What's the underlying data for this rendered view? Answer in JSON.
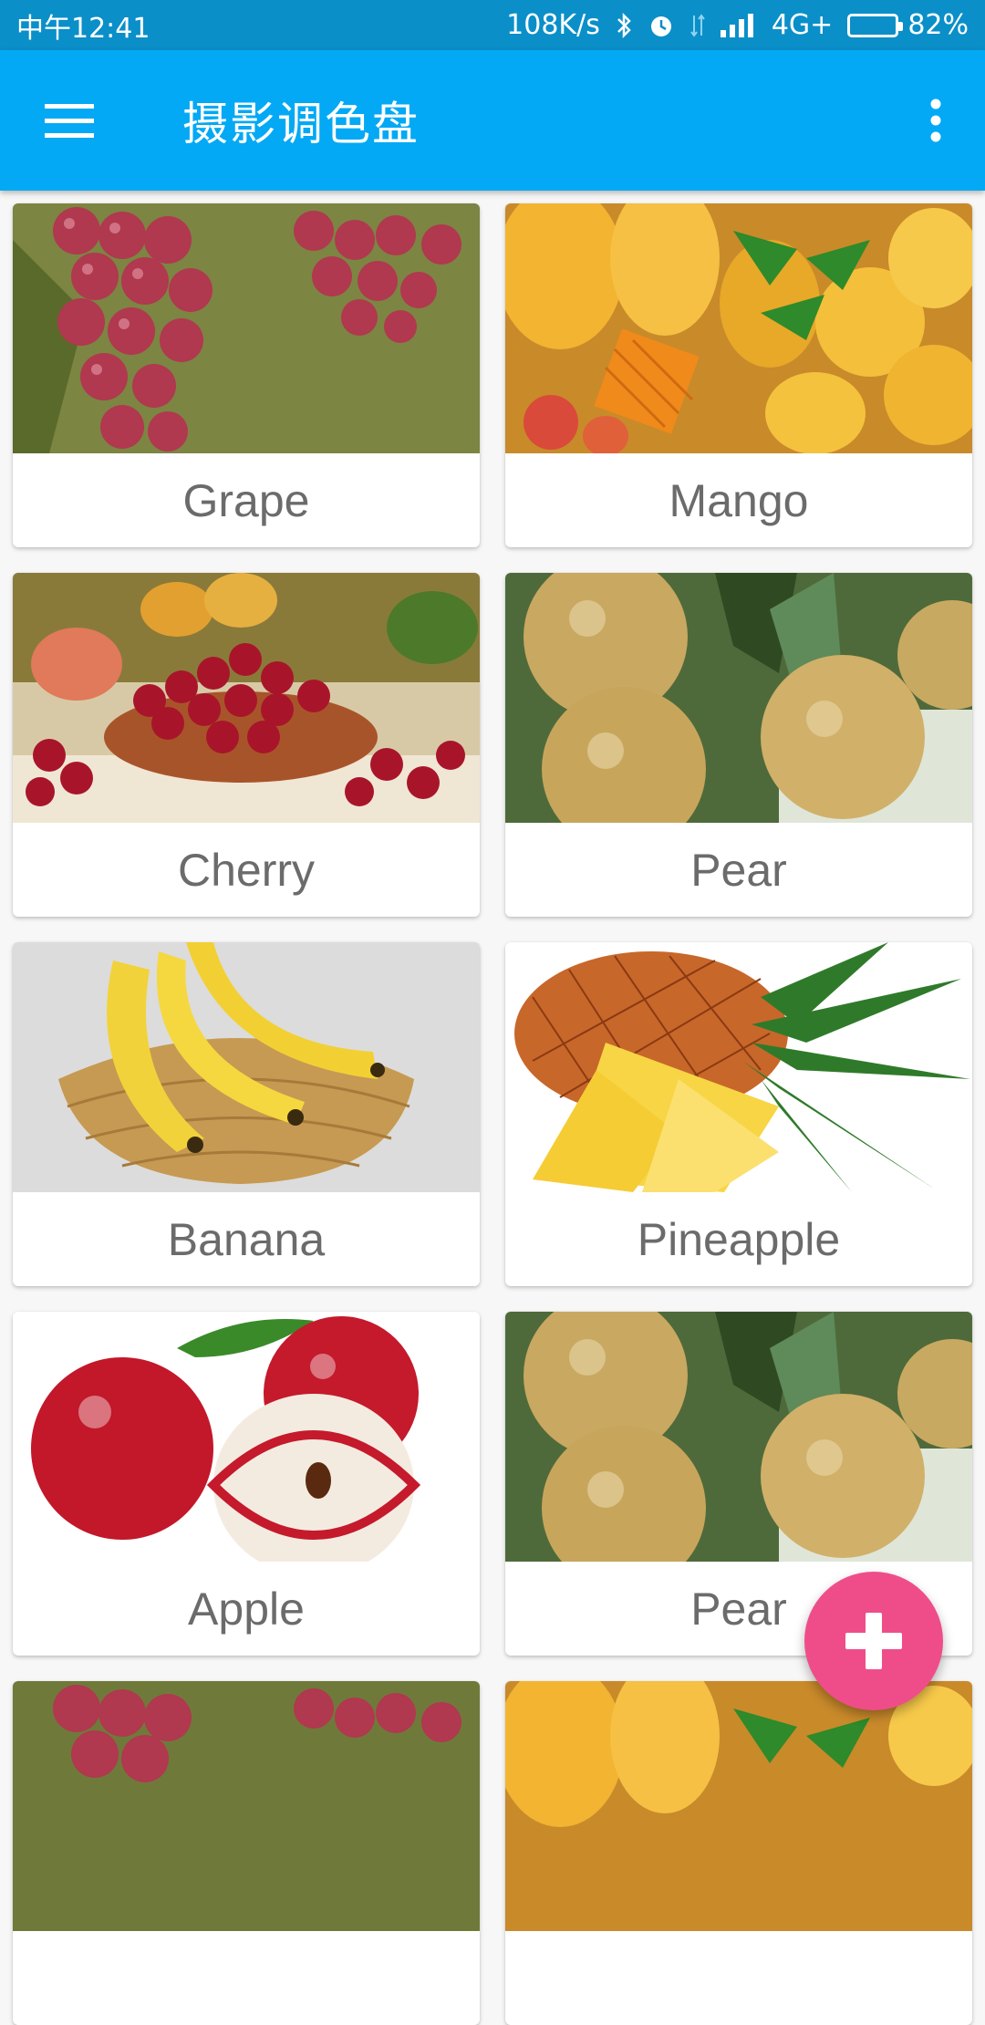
{
  "status_bar": {
    "time": "中午12:41",
    "net_speed": "108K/s",
    "network": "4G+",
    "battery_percent_text": "82%",
    "battery_level": 0.82,
    "icons": [
      "bluetooth-icon",
      "alarm-icon",
      "data-transfer-icon",
      "signal-icon",
      "battery-icon"
    ]
  },
  "app_bar": {
    "title": "摄影调色盘",
    "background": "#03a9f4",
    "icons": [
      "menu-icon",
      "more-vert-icon"
    ]
  },
  "fruits": [
    {
      "label": "Grape",
      "image": "grape-photo"
    },
    {
      "label": "Mango",
      "image": "mango-photo"
    },
    {
      "label": "Cherry",
      "image": "cherry-photo"
    },
    {
      "label": "Pear",
      "image": "pear-photo"
    },
    {
      "label": "Banana",
      "image": "banana-photo"
    },
    {
      "label": "Pineapple",
      "image": "pineapple-photo"
    },
    {
      "label": "Apple",
      "image": "apple-photo"
    },
    {
      "label": "Pear",
      "image": "pear-photo"
    },
    {
      "label": "",
      "image": "grape-photo"
    },
    {
      "label": "",
      "image": "mango-photo"
    }
  ],
  "fab": {
    "icon": "plus-icon",
    "color": "#ef4d8a"
  }
}
